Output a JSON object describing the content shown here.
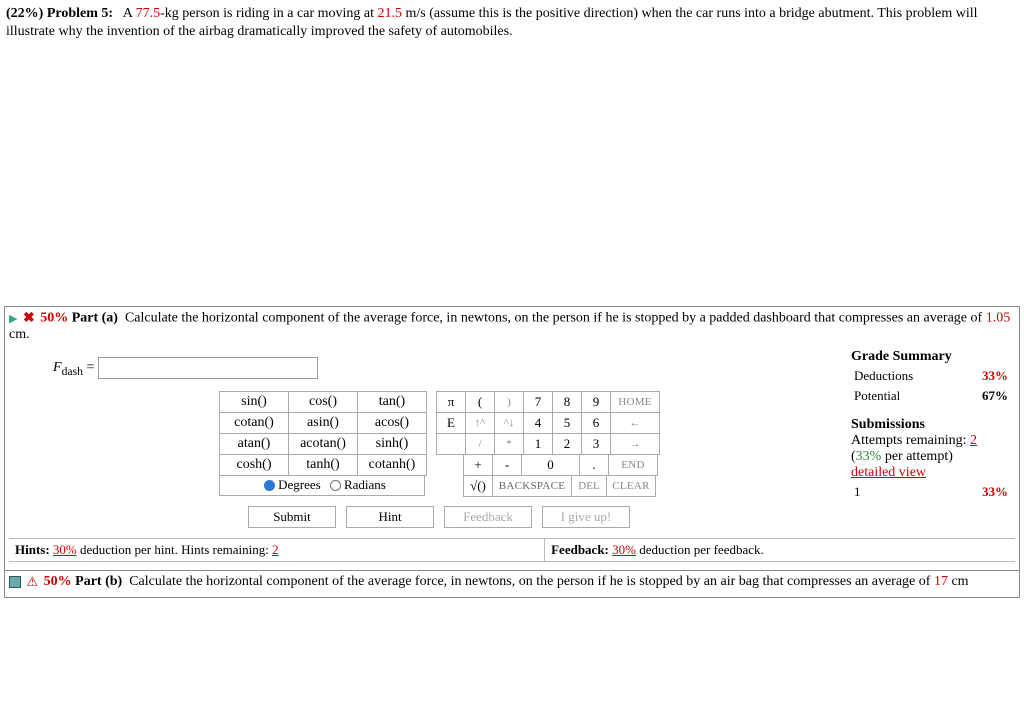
{
  "problem": {
    "weight": "(22%)",
    "label": "Problem 5:",
    "pre": "A",
    "mass": "77.5",
    "mid1": "-kg person is riding in a car moving at",
    "speed": "21.5",
    "mid2": "m/s (assume this is the positive direction) when the car runs into a bridge abutment. This problem will illustrate why the invention of the airbag dramatically improved the safety of automobiles."
  },
  "partA": {
    "weight": "50%",
    "label": "Part (a)",
    "text_pre": "Calculate the horizontal component of the average force, in newtons, on the person if he is stopped by a padded dashboard that compresses an average of",
    "dist": "1.05",
    "text_post": "cm.",
    "var": "F",
    "sub": "dash",
    "eq": "=",
    "input_value": ""
  },
  "grade": {
    "title": "Grade Summary",
    "ded_label": "Deductions",
    "ded_val": "33%",
    "pot_label": "Potential",
    "pot_val": "67%",
    "sub_title": "Submissions",
    "att_label": "Attempts remaining:",
    "att_val": "2",
    "per_pre": "(",
    "per_pct": "33%",
    "per_post": " per attempt)",
    "detailed": "detailed view",
    "rownum": "1",
    "rowval": "33%"
  },
  "fn": {
    "r1": [
      "sin()",
      "cos()",
      "tan()"
    ],
    "r2": [
      "cotan()",
      "asin()",
      "acos()"
    ],
    "r3": [
      "atan()",
      "acotan()",
      "sinh()"
    ],
    "r4": [
      "cosh()",
      "tanh()",
      "cotanh()"
    ],
    "deg": "Degrees",
    "rad": "Radians"
  },
  "num": {
    "r1": [
      "π",
      "(",
      ")",
      "7",
      "8",
      "9",
      "HOME"
    ],
    "r2": [
      "E",
      "↑^",
      "^↓",
      "4",
      "5",
      "6",
      "←"
    ],
    "r3": [
      "",
      "/",
      "*",
      "1",
      "2",
      "3",
      "→"
    ],
    "r4": [
      "+",
      "-",
      "0",
      ".",
      "END"
    ],
    "r5": [
      "√()",
      "BACKSPACE",
      "DEL",
      "CLEAR"
    ]
  },
  "btn": {
    "submit": "Submit",
    "hint": "Hint",
    "feedback": "Feedback",
    "giveup": "I give up!"
  },
  "hints": {
    "h_pre": "Hints:",
    "h_pct": "30%",
    "h_mid": "deduction per hint. Hints remaining:",
    "h_rem": "2",
    "f_pre": "Feedback:",
    "f_pct": "30%",
    "f_post": "deduction per feedback."
  },
  "partB": {
    "weight": "50%",
    "label": "Part (b)",
    "text_pre": "Calculate the horizontal component of the average force, in newtons, on the person if he is stopped by an air bag that compresses an average of",
    "dist": "17",
    "text_post": "cm"
  }
}
